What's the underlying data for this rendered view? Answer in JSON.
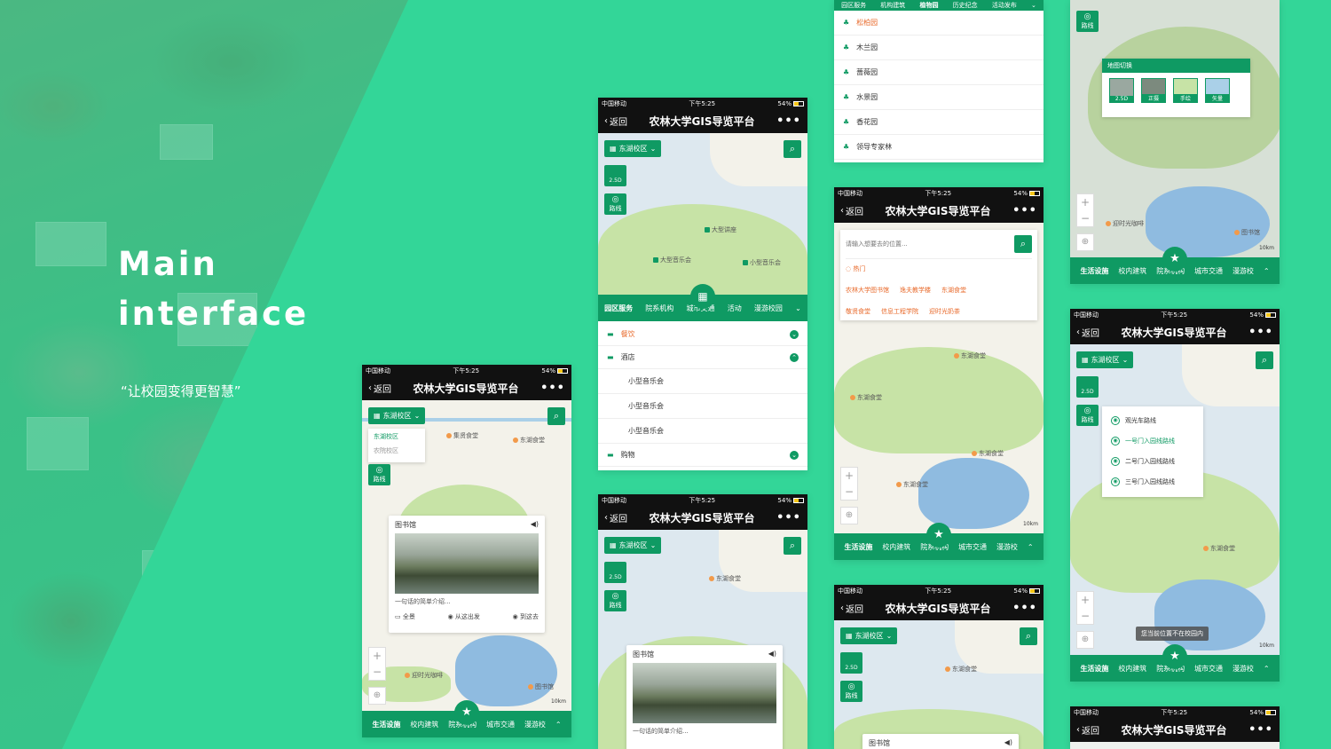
{
  "hero": {
    "title_line1": "Main",
    "title_line2": "interface",
    "subtitle": "“让校园变得更智慧”"
  },
  "phone": {
    "carrier": "中国移动",
    "time": "下午5:25",
    "battery": "54%",
    "back": "返回",
    "title": "农林大学GIS导览平台",
    "more": "•••"
  },
  "map": {
    "campus": "东湖校区",
    "btn_25d": "2.5D",
    "btn_route": "路线",
    "scale": "10km",
    "search_icon": "search-icon"
  },
  "campus_dropdown": [
    "东湖校区",
    "农院校区"
  ],
  "pois": {
    "jizhong": "集贤食堂",
    "donghu_canteen": "东湖食堂",
    "library": "图书馆",
    "timecafe": "迎时光咖啡",
    "big_music": "大型音乐会",
    "big_lecture": "大型讲座",
    "small_music": "小型音乐会",
    "yijiangxing": "逸夫教学楼",
    "dongshu": "东湖食堂"
  },
  "tabbar": [
    "生活设施",
    "校内建筑",
    "院系机构",
    "城市交通",
    "漫游校"
  ],
  "card": {
    "title": "图书馆",
    "desc": "一句话的简单介绍...",
    "act1": "全景",
    "act2": "从这出发",
    "act3": "到这去"
  },
  "subtabs": [
    "园区服务",
    "院系机构",
    "城市交通",
    "活动",
    "漫游校园"
  ],
  "service_list": {
    "cat1": "餐饮",
    "cat2": "酒店",
    "items": [
      "小型音乐会",
      "小型音乐会",
      "小型音乐会"
    ],
    "cat3": "购物"
  },
  "top_tabs": [
    "园区服务",
    "机构建筑",
    "植物园",
    "历史纪念",
    "活动发布"
  ],
  "garden_list": [
    "松柏园",
    "木兰园",
    "蔷薇园",
    "水景园",
    "香花园",
    "领导专家林"
  ],
  "search": {
    "placeholder": "请输入想要去的位置...",
    "hot_label": "热门",
    "hot": [
      "农林大学图书馆",
      "逸夫教学楼",
      "东湖食堂",
      "敬贤食堂",
      "信息工程学院",
      "迎时光奶茶"
    ]
  },
  "basemap": {
    "title": "地图切换",
    "options": [
      "2.5D",
      "正摄",
      "手绘",
      "矢量"
    ]
  },
  "routes": [
    "观光车路线",
    "一号门入园线路线",
    "二号门入园线路线",
    "三号门入园线路线"
  ],
  "toast": "您当前位置不在校园内"
}
